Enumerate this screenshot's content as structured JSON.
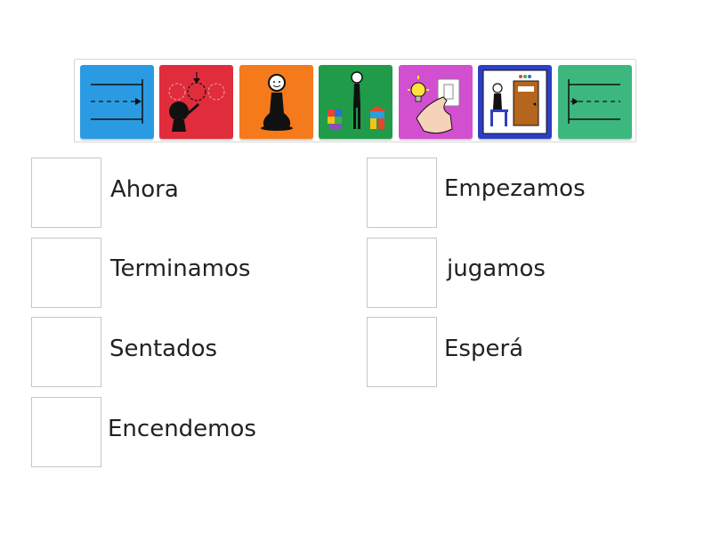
{
  "tiles": [
    {
      "icon": "arrow-right-lines-icon",
      "color": "#2a9be2"
    },
    {
      "icon": "wait-circles-icon",
      "color": "#e02d3c"
    },
    {
      "icon": "sitting-person-icon",
      "color": "#f57a1c"
    },
    {
      "icon": "person-playing-toys-icon",
      "color": "#1f9b4a"
    },
    {
      "icon": "light-switch-icon",
      "color": "#d24fcf"
    },
    {
      "icon": "classroom-door-icon",
      "color": "#2d3fc4"
    },
    {
      "icon": "start-line-arrow-icon",
      "color": "#3cb87e"
    }
  ],
  "items": [
    {
      "label": "Ahora"
    },
    {
      "label": "Empezamos"
    },
    {
      "label": "Terminamos"
    },
    {
      "label": "jugamos"
    },
    {
      "label": "Sentados"
    },
    {
      "label": "Esperá"
    },
    {
      "label": "Encendemos"
    }
  ]
}
